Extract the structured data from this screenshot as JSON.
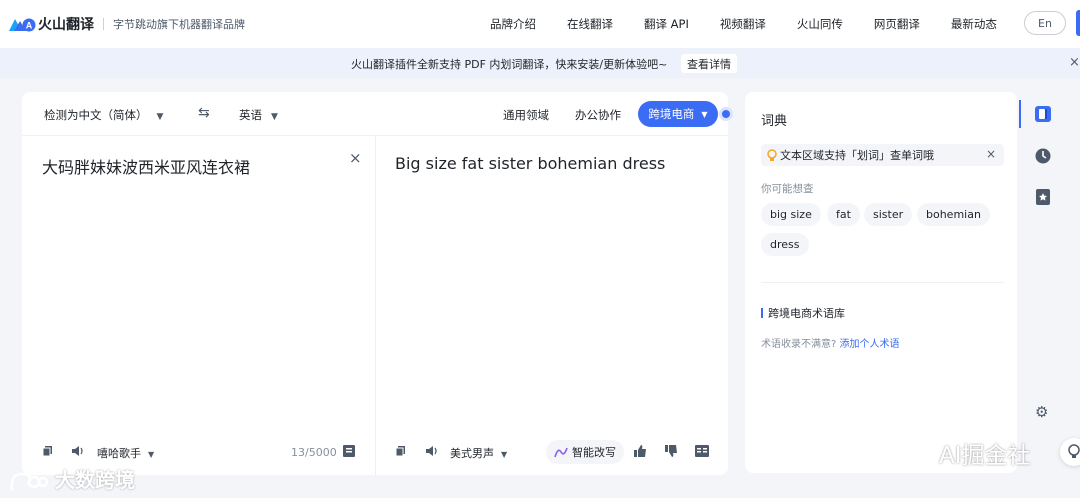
{
  "header": {
    "brand": "火山翻译",
    "tagline": "字节跳动旗下机器翻译品牌",
    "nav": [
      "品牌介绍",
      "在线翻译",
      "翻译 API",
      "视频翻译",
      "火山同传",
      "网页翻译",
      "最新动态"
    ],
    "lang_button": "En"
  },
  "banner": {
    "text": "火山翻译插件全新支持 PDF 内划词翻译，快来安装/更新体验吧~",
    "button": "查看详情",
    "close": "×"
  },
  "translator": {
    "source_lang": "检测为中文（简体）",
    "target_lang": "英语",
    "domains": [
      "通用领域",
      "办公协作"
    ],
    "active_domain": "跨境电商",
    "source_text": "大码胖妹妹波西米亚风连衣裙",
    "clear": "×",
    "target_text": "Big size fat sister bohemian dress",
    "source_voice": "嘻哈歌手",
    "char_count": "13/5000",
    "target_voice": "美式男声",
    "rewrite": "智能改写"
  },
  "dictionary": {
    "title": "词典",
    "tip": "文本区域支持「划词」查单词哦",
    "tip_close": "×",
    "maybe_label": "你可能想查",
    "suggestions": [
      "big size",
      "fat",
      "sister",
      "bohemian",
      "dress"
    ],
    "glossary_title": "跨境电商术语库",
    "glossary_note": "术语收录不满意?",
    "glossary_link": "添加个人术语"
  },
  "watermarks": {
    "left": "大数跨境",
    "right": "AI掘金社"
  },
  "colors": {
    "accent": "#3a6cf4",
    "background": "#f3f5f9"
  }
}
